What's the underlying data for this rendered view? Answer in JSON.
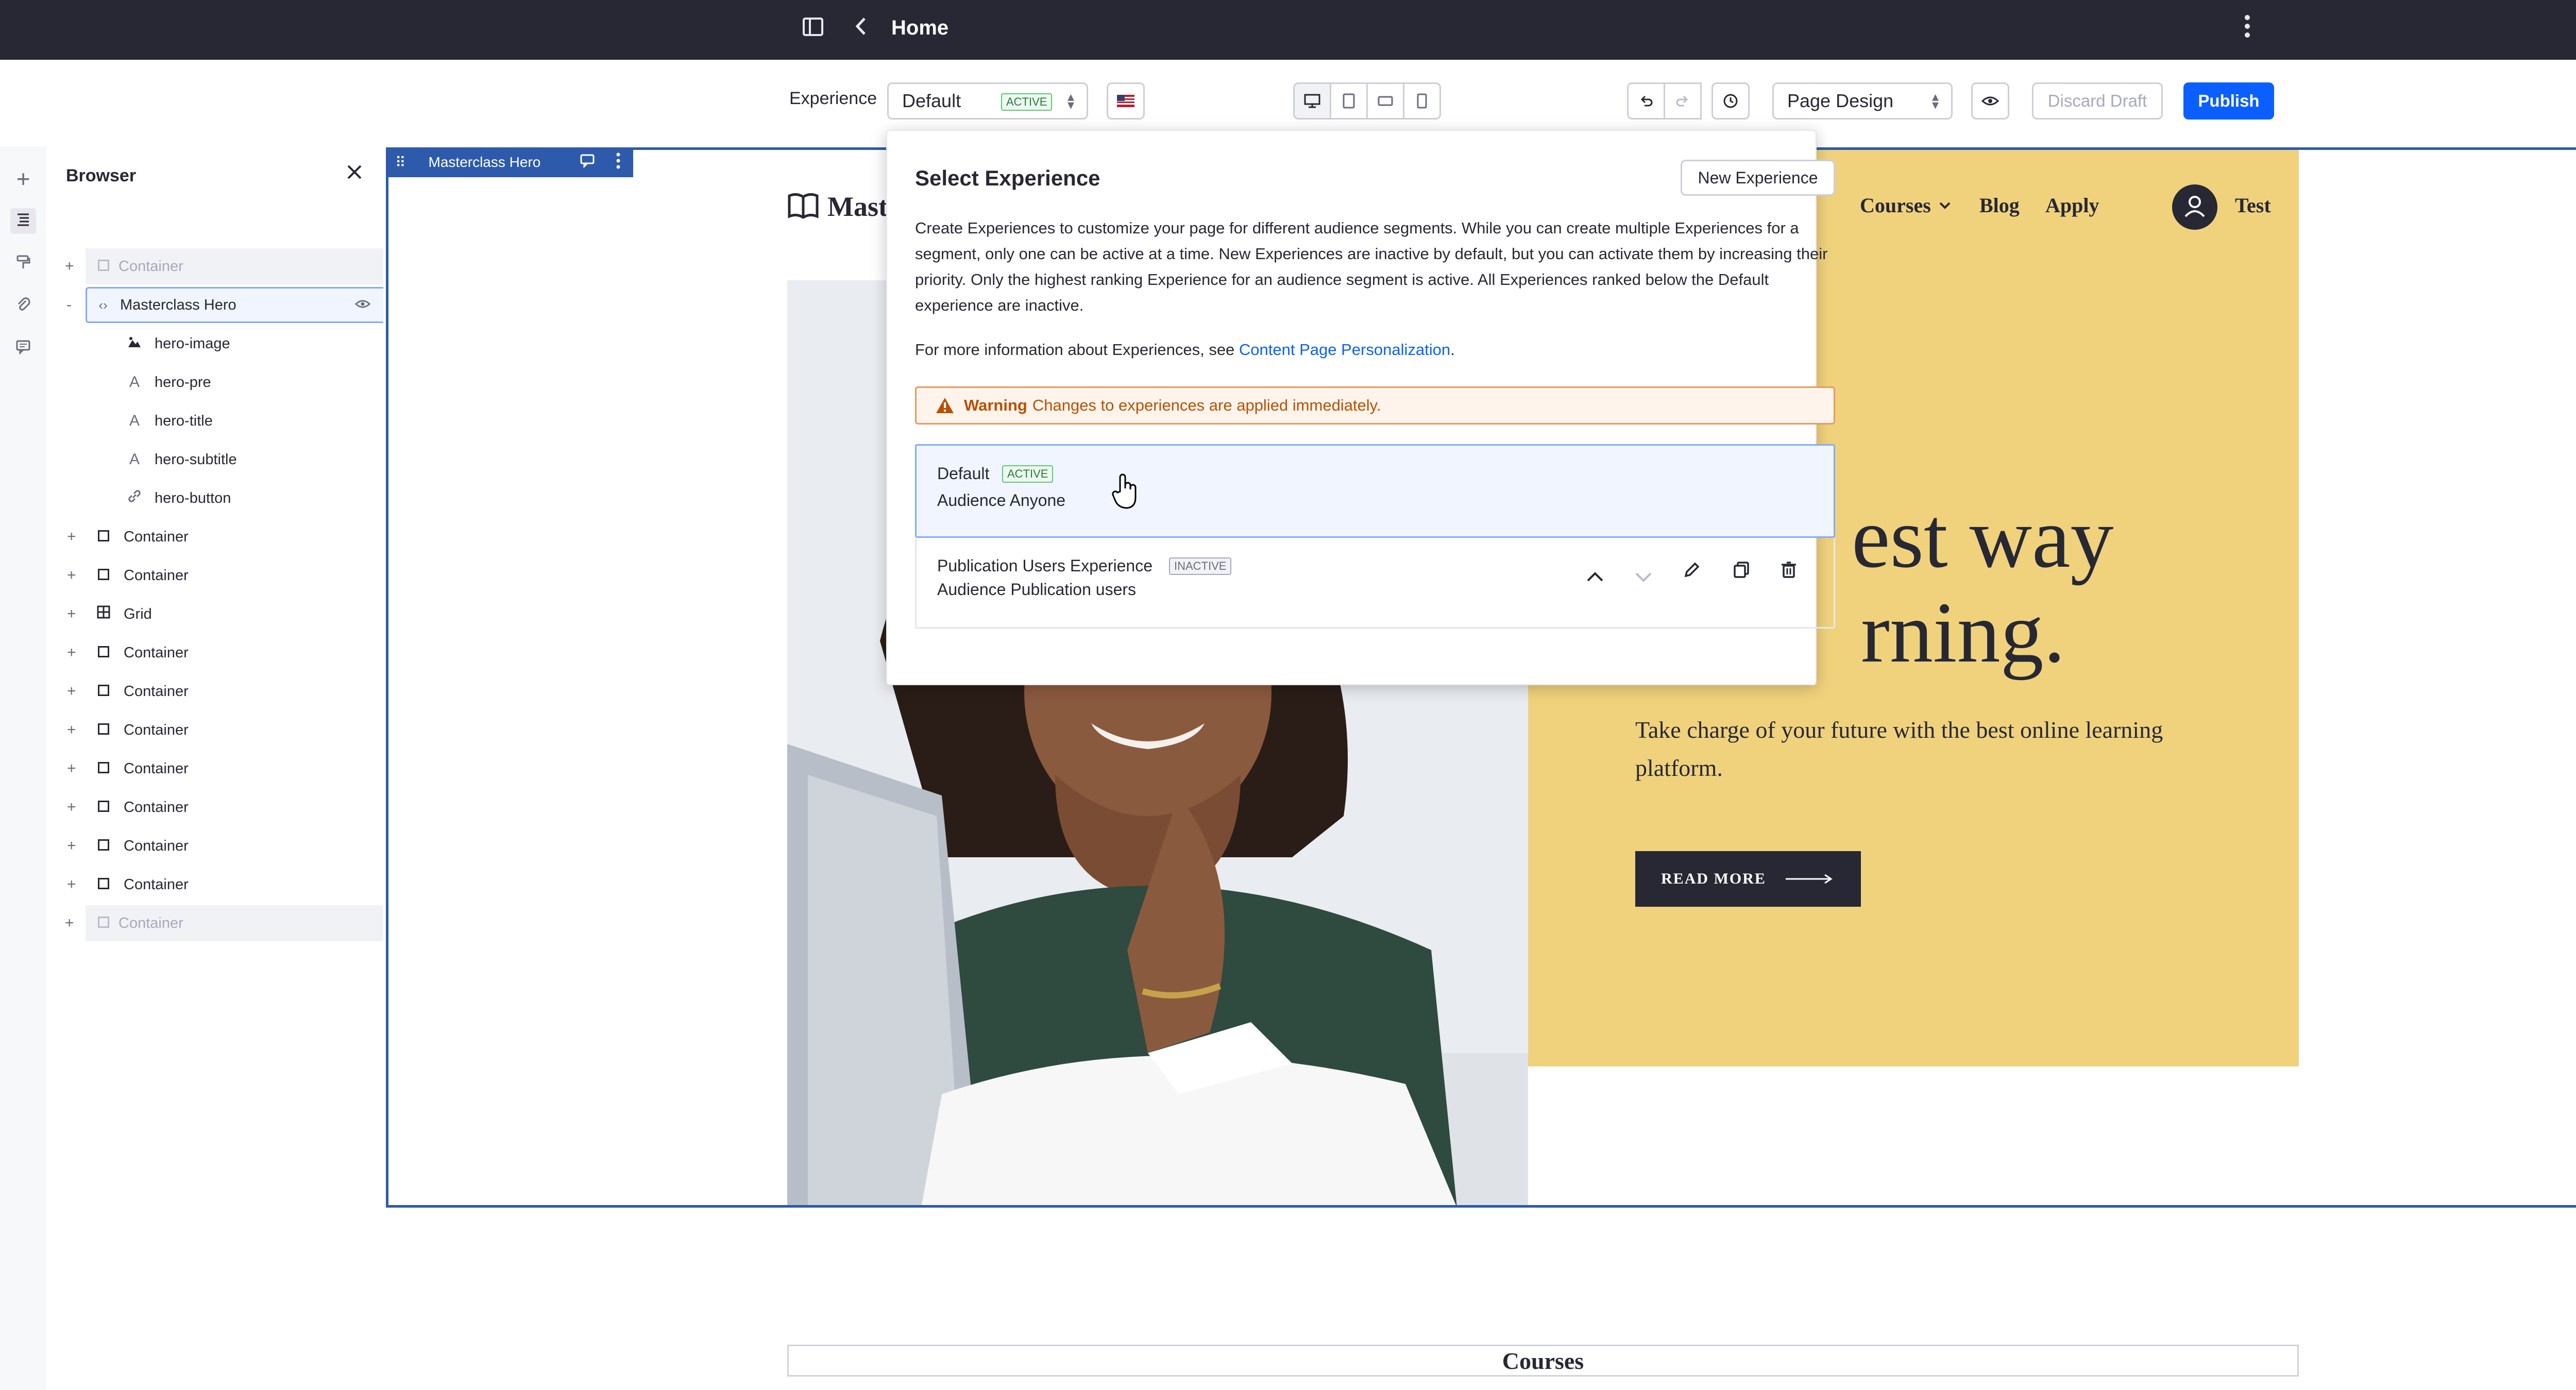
{
  "topbar": {
    "title": "Home"
  },
  "toolbar": {
    "experience_label": "Experience",
    "experience_value": "Default",
    "experience_badge": "ACTIVE",
    "page_design": "Page Design",
    "discard": "Discard Draft",
    "publish": "Publish"
  },
  "browser": {
    "title": "Browser",
    "items": [
      {
        "label": "Container"
      },
      {
        "label": "Masterclass Hero"
      },
      {
        "label": "hero-image"
      },
      {
        "label": "hero-pre"
      },
      {
        "label": "hero-title"
      },
      {
        "label": "hero-subtitle"
      },
      {
        "label": "hero-button"
      },
      {
        "label": "Container"
      },
      {
        "label": "Container"
      },
      {
        "label": "Grid"
      },
      {
        "label": "Container"
      },
      {
        "label": "Container"
      },
      {
        "label": "Container"
      },
      {
        "label": "Container"
      },
      {
        "label": "Container"
      },
      {
        "label": "Container"
      },
      {
        "label": "Container"
      },
      {
        "label": "Container"
      }
    ]
  },
  "fragment": {
    "tag": "Masterclass Hero"
  },
  "site": {
    "logo": "Mast",
    "nav": [
      "Courses",
      "Blog",
      "Apply"
    ],
    "user": "Test",
    "title_line1": "est way",
    "title_line2": "rning.",
    "subtitle": "Take charge of your future with the best online learning platform.",
    "button": "READ MORE",
    "courses": "Courses"
  },
  "popover": {
    "title": "Select Experience",
    "new_button": "New Experience",
    "description": "Create Experiences to customize your page for different audience segments. While you can create multiple Experiences for a segment, only one can be active at a time. New Experiences are inactive by default, but you can activate them by increasing their priority. Only the highest ranking Experience for an audience segment is active. All Experiences ranked below the Default experience are inactive.",
    "more_info_prefix": "For more information about Experiences, see ",
    "more_info_link": "Content Page Personalization",
    "more_info_suffix": ".",
    "warning_label": "Warning",
    "warning_text": "Changes to experiences are applied immediately.",
    "experiences": [
      {
        "name": "Default",
        "badge": "ACTIVE",
        "audience": "Audience Anyone"
      },
      {
        "name": "Publication Users Experience",
        "badge": "INACTIVE",
        "audience": "Audience Publication users"
      }
    ]
  },
  "colors": {
    "topbar": "#272833",
    "primary": "#0b5fff",
    "fragment_outline": "#2e5aac",
    "hero_yellow": "#f0d27d"
  }
}
